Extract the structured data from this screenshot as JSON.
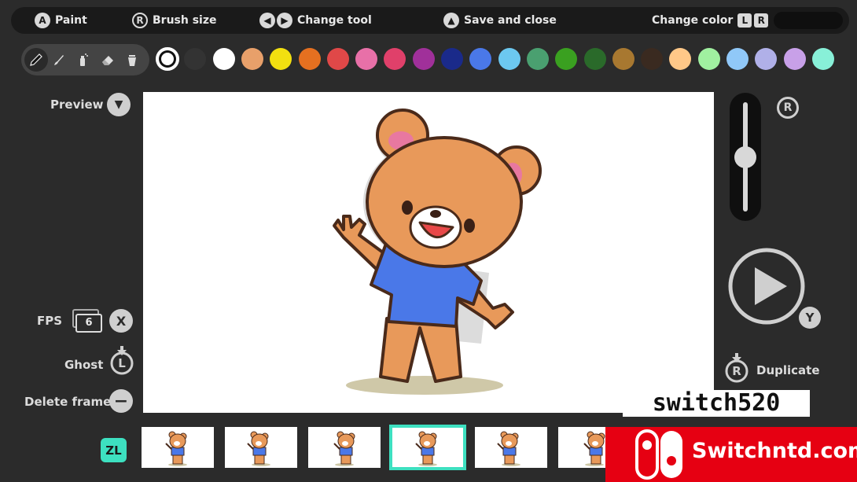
{
  "top_bar": {
    "paint": {
      "button": "A",
      "label": "Paint"
    },
    "brush_size": {
      "button": "R",
      "label": "Brush size"
    },
    "change_tool": {
      "label": "Change tool"
    },
    "save_close": {
      "label": "Save and close"
    },
    "change_color": {
      "label": "Change color",
      "key_left": "L",
      "key_right": "R"
    }
  },
  "tools": [
    "pencil-icon",
    "brush-icon",
    "spray-icon",
    "eraser-icon",
    "fill-bucket-icon"
  ],
  "palette": [
    "#ffffff",
    "#333333",
    "#ffffff",
    "#e8a06a",
    "#f2e010",
    "#e57020",
    "#e04848",
    "#e870a8",
    "#e0406a",
    "#a0309a",
    "#1a2a8a",
    "#4a78e8",
    "#6cc8f0",
    "#4aa070",
    "#3aa020",
    "#2a6a2a",
    "#a87830",
    "#3a2a20",
    "#ffc888",
    "#a0f0a0",
    "#90c8f8",
    "#b0b0e8",
    "#c8a0e8",
    "#88f0d8"
  ],
  "left_panel": {
    "preview": "Preview",
    "fps_label": "FPS",
    "fps_value": "6",
    "fps_button": "X",
    "ghost": "Ghost",
    "ghost_button": "L",
    "delete_frame": "Delete frame"
  },
  "right_panel": {
    "slider_button": "R",
    "play_button": "Y",
    "duplicate_button": "R",
    "duplicate": "Duplicate",
    "slider_level": 0.5
  },
  "frames": {
    "zl_label": "ZL",
    "count_visible": 6,
    "selected_index": 3
  },
  "watermarks": {
    "text1": "switch520",
    "text2": "Switchntd.com"
  },
  "colors": {
    "accent": "#3de0c0",
    "bear_fur": "#e8995a",
    "shirt": "#4a78e8"
  }
}
